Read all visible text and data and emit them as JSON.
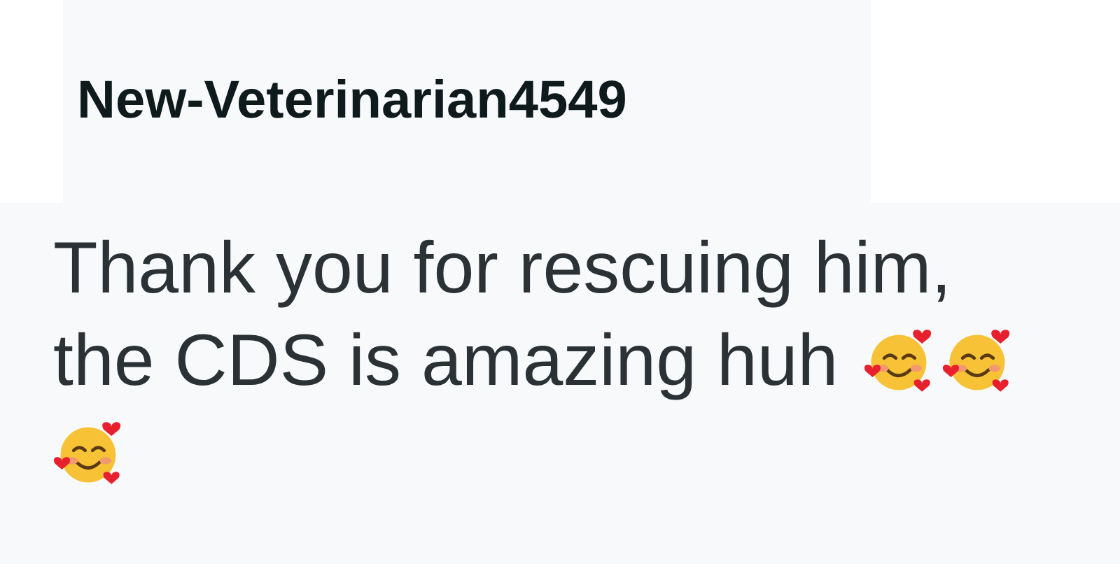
{
  "comment": {
    "author": "New-Veterinarian4549",
    "body_lines": [
      "Thank you for rescuing him,",
      "the CDS is amazing huh"
    ]
  }
}
